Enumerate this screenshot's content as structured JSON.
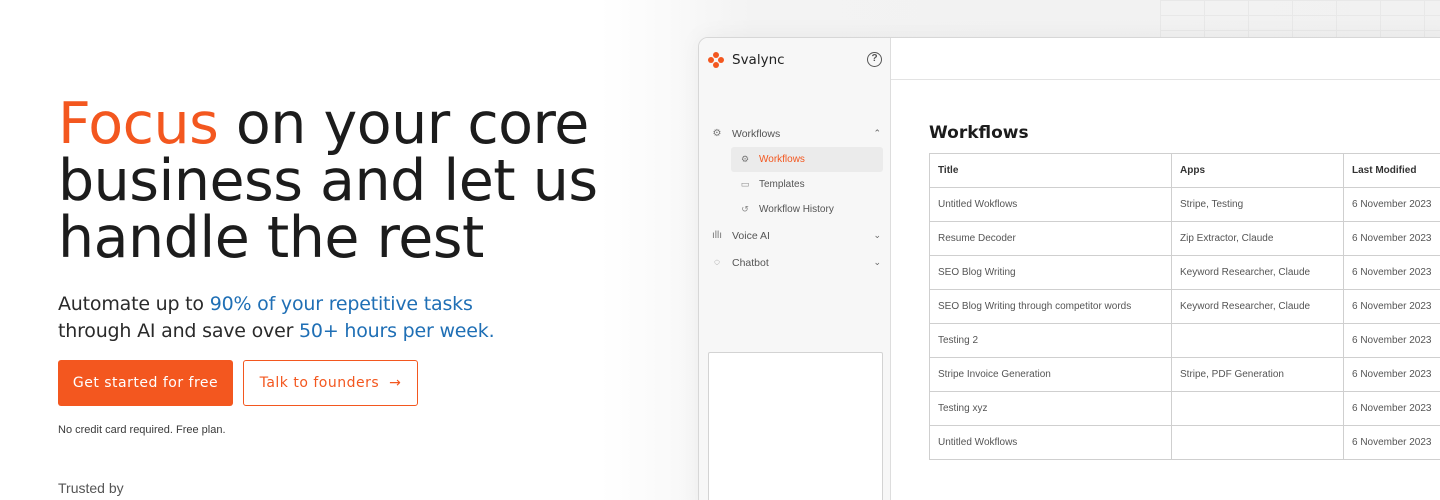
{
  "hero": {
    "headline_accent": "Focus",
    "headline_rest": " on your core business and let us handle the rest",
    "sub_line1_prefix": "Automate up to ",
    "sub_line1_highlight": "90% of your repetitive tasks",
    "sub_line2_prefix": "through AI and save over ",
    "sub_line2_highlight": "50+ hours per week.",
    "primary_cta": "Get started for free",
    "secondary_cta": "Talk to founders",
    "secondary_cta_icon": "arrow-right-icon",
    "fineprint": "No credit card required. Free plan.",
    "trusted_by": "Trusted by"
  },
  "colors": {
    "accent": "#f3571f",
    "highlight": "#1f6fb5"
  },
  "app": {
    "brand_name": "Svalync",
    "help_icon": "help-circle-icon",
    "sidebar": {
      "groups": [
        {
          "label": "Workflows",
          "icon": "workflow-icon",
          "expanded": true,
          "items": [
            {
              "label": "Workflows",
              "icon": "workflow-icon",
              "active": true
            },
            {
              "label": "Templates",
              "icon": "template-icon",
              "active": false
            },
            {
              "label": "Workflow History",
              "icon": "history-icon",
              "active": false
            }
          ]
        },
        {
          "label": "Voice AI",
          "icon": "voice-icon",
          "expanded": false
        },
        {
          "label": "Chatbot",
          "icon": "chatbot-icon",
          "expanded": false
        }
      ]
    },
    "main": {
      "title": "Workflows",
      "columns": [
        "Title",
        "Apps",
        "Last Modified"
      ],
      "rows": [
        {
          "title": "Untitled Wokflows",
          "apps": "Stripe, Testing",
          "modified": "6 November 2023"
        },
        {
          "title": "Resume Decoder",
          "apps": "Zip Extractor, Claude",
          "modified": "6 November 2023"
        },
        {
          "title": "SEO Blog Writing",
          "apps": "Keyword Researcher, Claude",
          "modified": "6 November 2023"
        },
        {
          "title": "SEO Blog Writing through competitor words",
          "apps": "Keyword Researcher, Claude",
          "modified": "6 November 2023"
        },
        {
          "title": "Testing 2",
          "apps": "",
          "modified": "6 November 2023"
        },
        {
          "title": "Stripe Invoice Generation",
          "apps": "Stripe, PDF Generation",
          "modified": "6 November 2023"
        },
        {
          "title": "Testing xyz",
          "apps": "",
          "modified": "6 November 2023"
        },
        {
          "title": "Untitled Wokflows",
          "apps": "",
          "modified": "6 November 2023"
        }
      ]
    }
  }
}
